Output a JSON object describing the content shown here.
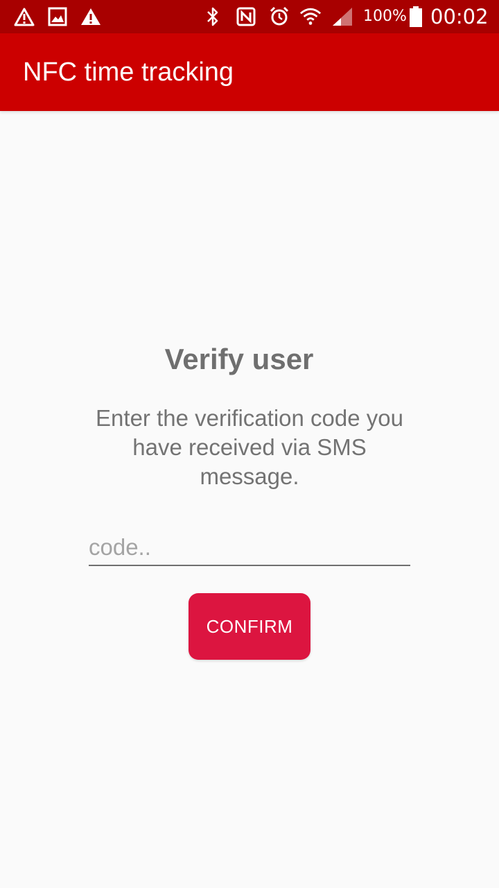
{
  "status_bar": {
    "background": "#a80000",
    "left_icons": [
      "warning-icon",
      "image-icon",
      "alert-icon"
    ],
    "right_icons": [
      "bluetooth-icon",
      "nfc-icon",
      "alarm-icon",
      "wifi-icon",
      "signal-icon",
      "battery-icon"
    ],
    "battery_level": "100%",
    "time": "00:02"
  },
  "app_bar": {
    "title": "NFC time tracking",
    "background": "#cc0000"
  },
  "verify": {
    "heading": "Verify user",
    "description": "Enter the verification code you have received via SMS message.",
    "code_value": "",
    "code_placeholder": "code..",
    "confirm_label": "CONFIRM",
    "button_color": "#dc1540"
  }
}
